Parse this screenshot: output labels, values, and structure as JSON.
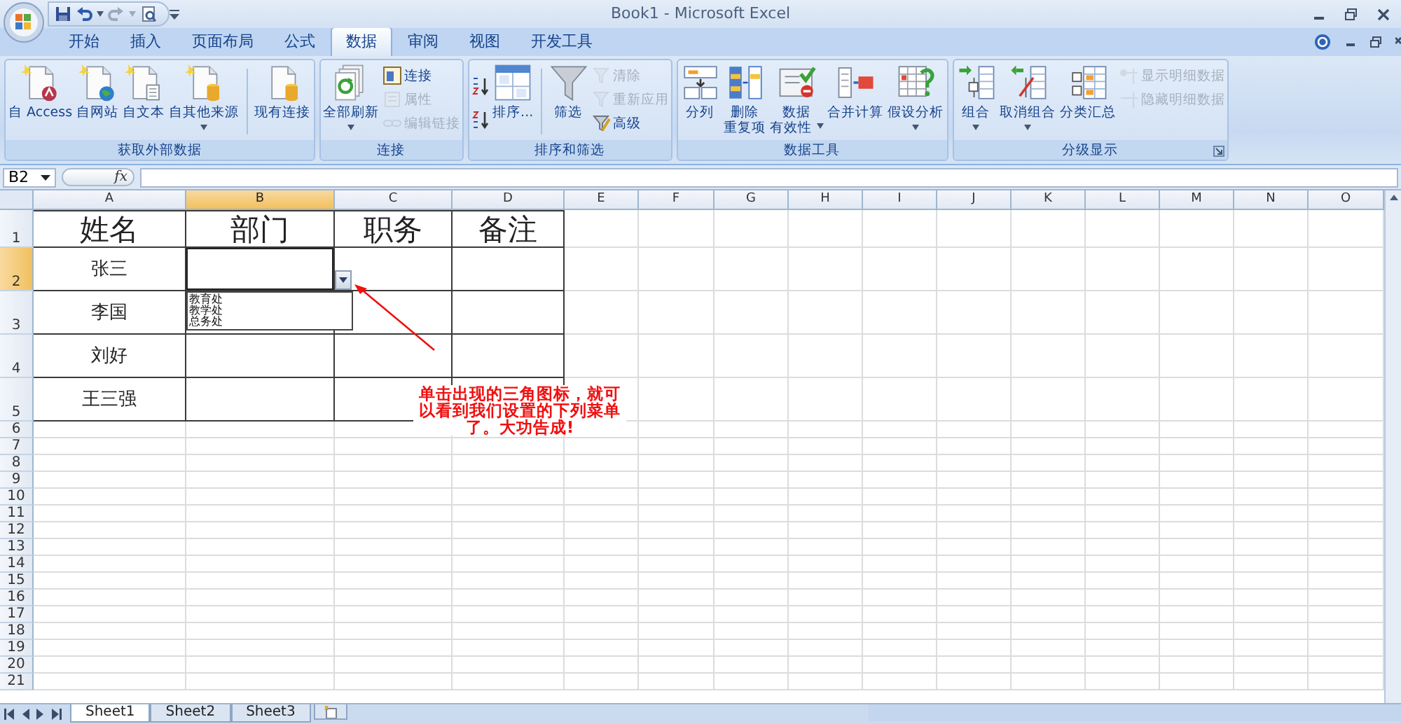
{
  "window": {
    "title": "Book1 - Microsoft Excel"
  },
  "tabs": [
    {
      "label": "开始",
      "selected": false
    },
    {
      "label": "插入",
      "selected": false
    },
    {
      "label": "页面布局",
      "selected": false
    },
    {
      "label": "公式",
      "selected": false
    },
    {
      "label": "数据",
      "selected": true
    },
    {
      "label": "审阅",
      "selected": false
    },
    {
      "label": "视图",
      "selected": false
    },
    {
      "label": "开发工具",
      "selected": false
    }
  ],
  "ribbon": {
    "groups": [
      {
        "label": "获取外部数据",
        "launcher": false,
        "items": [
          {
            "kind": "large",
            "lines": [
              "自 Access"
            ],
            "dropdown": false,
            "disabled": false
          },
          {
            "kind": "large",
            "lines": [
              "自网站"
            ],
            "dropdown": false,
            "disabled": false
          },
          {
            "kind": "large",
            "lines": [
              "自文本"
            ],
            "dropdown": false,
            "disabled": false
          },
          {
            "kind": "large",
            "lines": [
              "自其他来源"
            ],
            "dropdown": true,
            "disabled": false
          },
          {
            "kind": "separator"
          },
          {
            "kind": "large",
            "lines": [
              "现有连接"
            ],
            "dropdown": false,
            "disabled": false
          }
        ]
      },
      {
        "label": "连接",
        "launcher": false,
        "items": [
          {
            "kind": "large",
            "lines": [
              "全部刷新"
            ],
            "dropdown": true,
            "disabled": false
          },
          {
            "kind": "small",
            "label": "连接",
            "disabled": false
          },
          {
            "kind": "small",
            "label": "属性",
            "disabled": true
          },
          {
            "kind": "small",
            "label": "编辑链接",
            "disabled": true
          }
        ]
      },
      {
        "label": "排序和筛选",
        "launcher": false,
        "items": [
          {
            "kind": "icon",
            "disabled": false
          },
          {
            "kind": "icon",
            "disabled": false
          },
          {
            "kind": "large",
            "lines": [
              "排序..."
            ],
            "dropdown": false,
            "disabled": false
          },
          {
            "kind": "separator"
          },
          {
            "kind": "large",
            "lines": [
              "筛选"
            ],
            "dropdown": false,
            "disabled": false
          },
          {
            "kind": "small",
            "label": "清除",
            "disabled": true
          },
          {
            "kind": "small",
            "label": "重新应用",
            "disabled": true
          },
          {
            "kind": "small",
            "label": "高级",
            "disabled": false
          }
        ]
      },
      {
        "label": "数据工具",
        "launcher": false,
        "items": [
          {
            "kind": "large",
            "lines": [
              "分列"
            ],
            "dropdown": false,
            "disabled": false
          },
          {
            "kind": "large",
            "lines": [
              "删除",
              "重复项"
            ],
            "dropdown": false,
            "disabled": false
          },
          {
            "kind": "large",
            "lines": [
              "数据",
              "有效性"
            ],
            "dropdown": true,
            "disabled": false
          },
          {
            "kind": "large",
            "lines": [
              "合并计算"
            ],
            "dropdown": false,
            "disabled": false
          },
          {
            "kind": "large",
            "lines": [
              "假设分析"
            ],
            "dropdown": true,
            "disabled": false
          }
        ]
      },
      {
        "label": "分级显示",
        "launcher": true,
        "items": [
          {
            "kind": "large",
            "lines": [
              "组合"
            ],
            "dropdown": true,
            "disabled": false
          },
          {
            "kind": "large",
            "lines": [
              "取消组合"
            ],
            "dropdown": true,
            "disabled": false
          },
          {
            "kind": "large",
            "lines": [
              "分类汇总"
            ],
            "dropdown": false,
            "disabled": false
          },
          {
            "kind": "small",
            "label": "显示明细数据",
            "disabled": true
          },
          {
            "kind": "small",
            "label": "隐藏明细数据",
            "disabled": true
          }
        ]
      }
    ]
  },
  "formula_bar": {
    "name_box": "B2",
    "function_label": "fx"
  },
  "sheet": {
    "columns": [
      {
        "label": "A",
        "selected": false
      },
      {
        "label": "B",
        "selected": true
      },
      {
        "label": "C",
        "selected": false
      },
      {
        "label": "D",
        "selected": false
      },
      {
        "label": "E",
        "selected": false
      },
      {
        "label": "F",
        "selected": false
      },
      {
        "label": "G",
        "selected": false
      },
      {
        "label": "H",
        "selected": false
      },
      {
        "label": "I",
        "selected": false
      },
      {
        "label": "J",
        "selected": false
      },
      {
        "label": "K",
        "selected": false
      },
      {
        "label": "L",
        "selected": false
      },
      {
        "label": "M",
        "selected": false
      },
      {
        "label": "N",
        "selected": false
      },
      {
        "label": "O",
        "selected": false
      }
    ],
    "rows": [
      {
        "label": "1",
        "selected": false,
        "kind": "heading",
        "cells": [
          "姓名",
          "部门",
          "职务",
          "备注"
        ]
      },
      {
        "label": "2",
        "selected": true,
        "kind": "data",
        "cells": [
          "张三",
          "",
          "",
          ""
        ]
      },
      {
        "label": "3",
        "selected": false,
        "kind": "data",
        "cells": [
          "李国",
          "",
          "",
          ""
        ]
      },
      {
        "label": "4",
        "selected": false,
        "kind": "data",
        "cells": [
          "刘好",
          "",
          "",
          ""
        ]
      },
      {
        "label": "5",
        "selected": false,
        "kind": "data",
        "cells": [
          "王三强",
          "",
          "",
          ""
        ]
      },
      {
        "label": "6",
        "selected": false,
        "kind": "blank"
      },
      {
        "label": "7",
        "selected": false,
        "kind": "blank"
      },
      {
        "label": "8",
        "selected": false,
        "kind": "blank"
      },
      {
        "label": "9",
        "selected": false,
        "kind": "blank"
      },
      {
        "label": "10",
        "selected": false,
        "kind": "blank"
      },
      {
        "label": "11",
        "selected": false,
        "kind": "blank"
      },
      {
        "label": "12",
        "selected": false,
        "kind": "blank"
      },
      {
        "label": "13",
        "selected": false,
        "kind": "blank"
      },
      {
        "label": "14",
        "selected": false,
        "kind": "blank"
      },
      {
        "label": "15",
        "selected": false,
        "kind": "blank"
      },
      {
        "label": "16",
        "selected": false,
        "kind": "blank"
      },
      {
        "label": "17",
        "selected": false,
        "kind": "blank"
      },
      {
        "label": "18",
        "selected": false,
        "kind": "blank"
      },
      {
        "label": "19",
        "selected": false,
        "kind": "blank"
      },
      {
        "label": "20",
        "selected": false,
        "kind": "blank"
      },
      {
        "label": "21",
        "selected": false,
        "kind": "blank"
      }
    ],
    "dropdown_list": [
      "教育处",
      "教学处",
      "总务处"
    ],
    "annotation": "单击出现的三角图标，就可以看到我们设置的下列菜单了。大功告成!"
  },
  "sheet_tabs": [
    {
      "label": "Sheet1",
      "selected": true
    },
    {
      "label": "Sheet2",
      "selected": false
    },
    {
      "label": "Sheet3",
      "selected": false
    }
  ]
}
